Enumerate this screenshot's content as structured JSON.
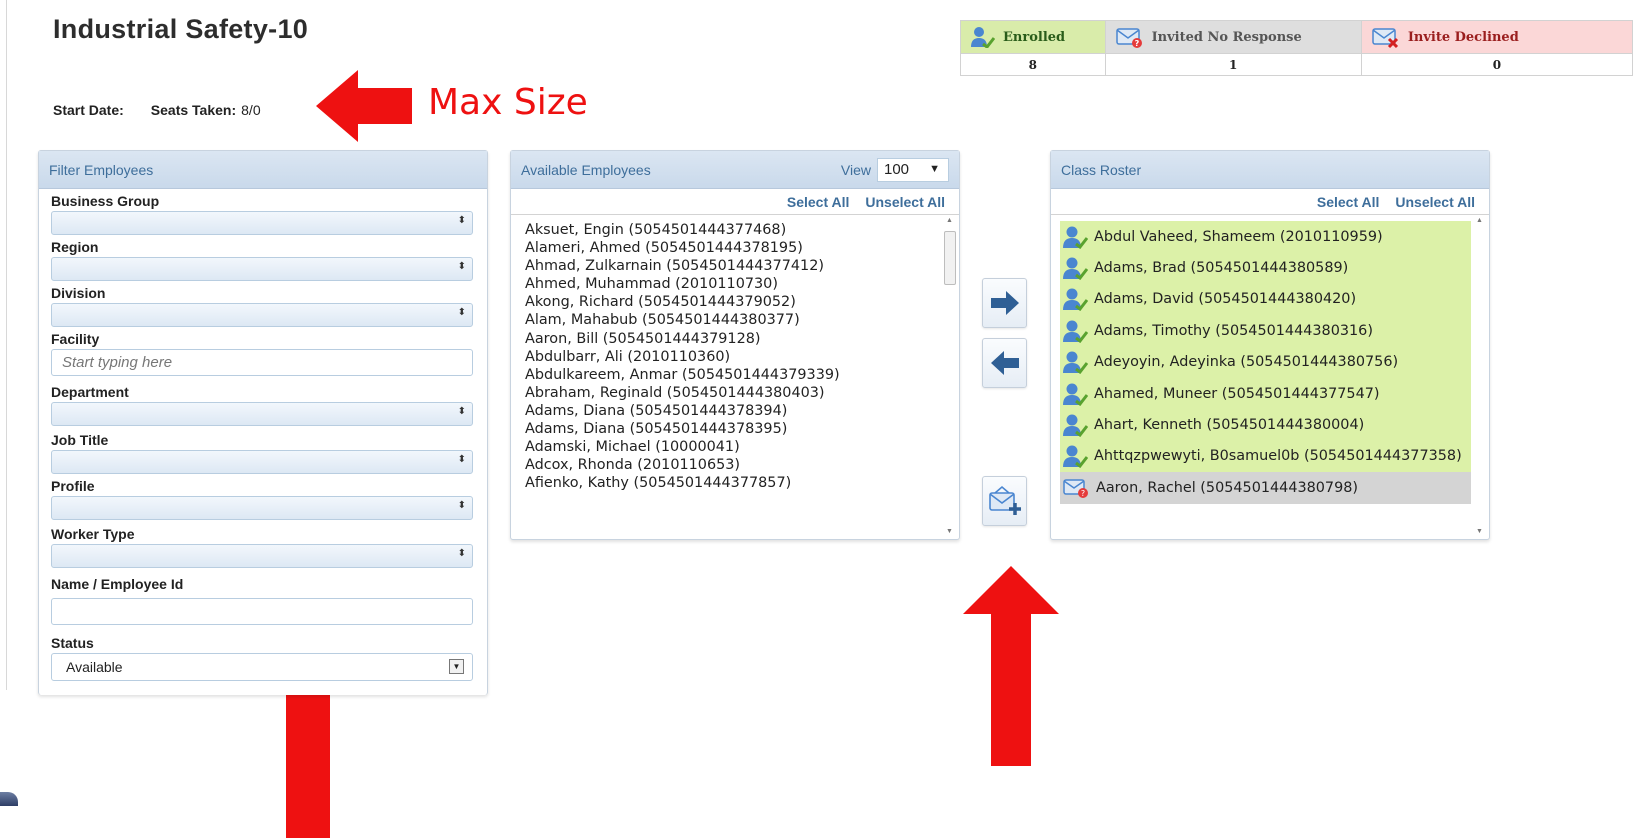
{
  "page": {
    "title": "Industrial Safety-10",
    "start_date_label": "Start Date:",
    "start_date_value": "",
    "seats_label": "Seats Taken:",
    "seats_value": "8/0",
    "annotation": "Max Size"
  },
  "status_summary": [
    {
      "label": "Enrolled",
      "count": "8",
      "icon": "enrolled-user-icon",
      "color": "#d9ecaa"
    },
    {
      "label": "Invited No Response",
      "count": "1",
      "icon": "invited-envelope-icon",
      "color": "#dedede"
    },
    {
      "label": "Invite Declined",
      "count": "0",
      "icon": "declined-envelope-icon",
      "color": "#fbd7d7"
    }
  ],
  "filter": {
    "title": "Filter Employees",
    "business_group": "Business Group",
    "region": "Region",
    "division": "Division",
    "facility": "Facility",
    "facility_placeholder": "Start typing here",
    "department": "Department",
    "job_title": "Job Title",
    "profile": "Profile",
    "worker_type": "Worker Type",
    "name_id": "Name / Employee Id",
    "status_label": "Status",
    "status_value": "Available"
  },
  "available": {
    "title": "Available Employees",
    "view_label": "View",
    "view_value": "100",
    "select_all": "Select All",
    "unselect_all": "Unselect All",
    "employees": [
      "Aksuet, Engin (5054501444377468)",
      "Alameri, Ahmed (5054501444378195)",
      "Ahmad, Zulkarnain (5054501444377412)",
      "Ahmed, Muhammad (2010110730)",
      "Akong, Richard (5054501444379052)",
      "Alam, Mahabub (5054501444380377)",
      "Aaron, Bill (5054501444379128)",
      "Abdulbarr, Ali (2010110360)",
      "Abdulkareem, Anmar (5054501444379339)",
      "Abraham, Reginald (5054501444380403)",
      "Adams, Diana (5054501444378394)",
      "Adams, Diana (5054501444378395)",
      "Adamski, Michael (10000041)",
      "Adcox, Rhonda (2010110653)",
      "Afienko, Kathy (5054501444377857)"
    ]
  },
  "roster": {
    "title": "Class Roster",
    "select_all": "Select All",
    "unselect_all": "Unselect All",
    "members": [
      {
        "name": "Abdul Vaheed, Shameem (2010110959)",
        "status": "enrolled"
      },
      {
        "name": "Adams, Brad (5054501444380589)",
        "status": "enrolled"
      },
      {
        "name": "Adams, David (5054501444380420)",
        "status": "enrolled"
      },
      {
        "name": "Adams, Timothy (5054501444380316)",
        "status": "enrolled"
      },
      {
        "name": "Adeyoyin, Adeyinka (5054501444380756)",
        "status": "enrolled"
      },
      {
        "name": "Ahamed, Muneer (5054501444377547)",
        "status": "enrolled"
      },
      {
        "name": "Ahart, Kenneth (5054501444380004)",
        "status": "enrolled"
      },
      {
        "name": "Ahttqzpwewyti, B0samuel0b (5054501444377358)",
        "status": "enrolled"
      },
      {
        "name": "Aaron, Rachel (5054501444380798)",
        "status": "invited"
      }
    ]
  },
  "colors": {
    "panel_header_text": "#3e6e9b",
    "enrolled_row": "#dcf1a8",
    "invited_row": "#d4d4d4",
    "annotation_red": "#ee1111"
  }
}
